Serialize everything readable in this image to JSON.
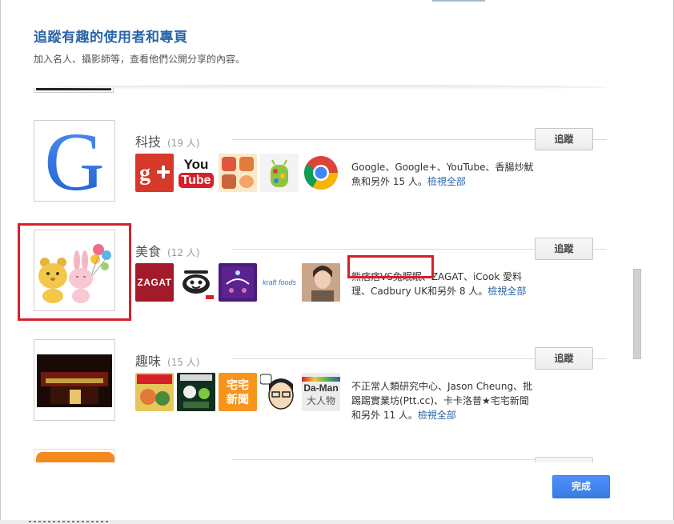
{
  "header": {
    "title": "追蹤有趣的使用者和專頁",
    "subtitle": "加入名人、攝影師等，查看他們公開分享的內容。"
  },
  "categories": [
    {
      "name": "科技",
      "count": "(19 人)",
      "follow_label": "追蹤",
      "desc": "Google、Google+、YouTube、香腸炒魷魚和另外 15 人。",
      "view_all": "檢視全部",
      "icons": [
        "google-plus-logo",
        "youtube-logo",
        "sausage-squid-logo",
        "android-jellybean",
        "chrome-logo"
      ]
    },
    {
      "name": "美食",
      "count": "(12 人)",
      "follow_label": "追蹤",
      "desc": "熊痞痞VS兔眠眠、ZAGAT、iCook 愛料理、Cadbury UK和另外 8 人。",
      "view_all": "檢視全部",
      "icons": [
        "zagat-logo",
        "icook-logo",
        "cadbury-logo",
        "kraft-foods-logo",
        "portrait-photo"
      ]
    },
    {
      "name": "趣味",
      "count": "(15 人)",
      "follow_label": "追蹤",
      "desc": "不正常人類研究中心、Jason Cheung、批踢踢實業坊(Ptt.cc)、卡卡洛普★宅宅新聞和另外 11 人。",
      "view_all": "檢視全部",
      "icons": [
        "comic-poster",
        "game-poster",
        "otaku-news-logo",
        "cartoon-face",
        "da-man-logo"
      ]
    }
  ],
  "icon_text": {
    "youtube_top": "You",
    "youtube_bottom": "Tube",
    "zagat": "ZAGAT",
    "kraft": "kraft foods",
    "otaku_1": "宅宅",
    "otaku_2": "新聞",
    "daman_1": "Da-Man",
    "daman_2": "大人物"
  },
  "footer": {
    "done_label": "完成"
  },
  "colors": {
    "title_blue": "#2a65a8",
    "primary_button": "#4d90fe",
    "highlight_red": "#d6202a"
  }
}
